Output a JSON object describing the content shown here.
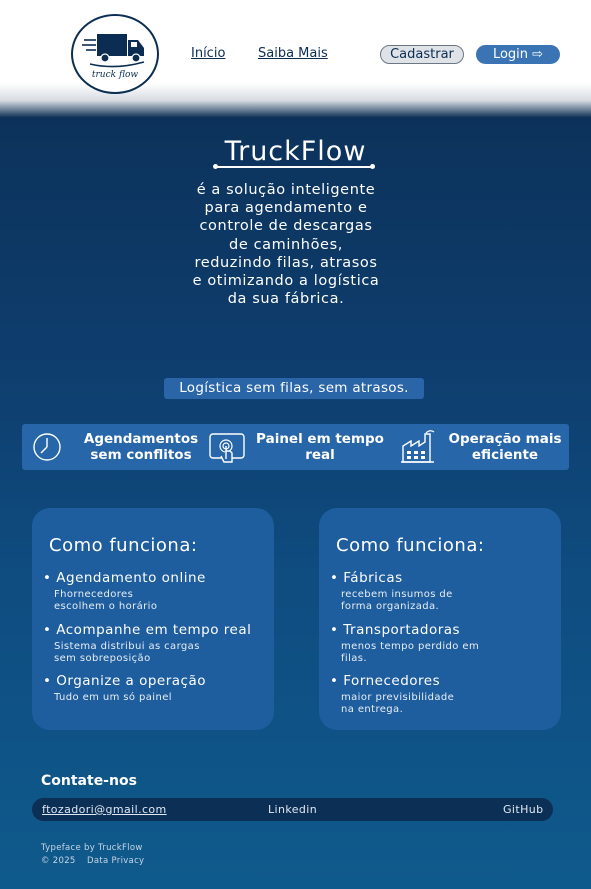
{
  "header": {
    "logo_text": "truck flow",
    "nav": {
      "home": "Início",
      "about": "Saiba Mais"
    },
    "register_label": "Cadastrar",
    "login_label": "Login ⇨"
  },
  "hero": {
    "title": "TruckFlow",
    "description": "é a solução inteligente para agendamento e controle de descargas de caminhões, reduzindo filas, atrasos e otimizando a logística da sua fábrica.",
    "tagline": "Logística sem filas, sem atrasos."
  },
  "features": [
    {
      "icon": "clock-icon",
      "label": "Agendamentos sem conflitos"
    },
    {
      "icon": "touch-panel-icon",
      "label": "Painel em tempo real"
    },
    {
      "icon": "factory-icon",
      "label": "Operação mais eficiente"
    }
  ],
  "cards": [
    {
      "title": "Como funciona:",
      "items": [
        {
          "title": "Agendamento online",
          "sub1": "Fhornecedores",
          "sub2": "escolhem o horário"
        },
        {
          "title": "Acompanhe em tempo real",
          "sub1": "Sistema distribui as cargas",
          "sub2": "sem sobreposição"
        },
        {
          "title": "Organize a operação",
          "sub1": "Tudo em um só painel",
          "sub2": ""
        }
      ]
    },
    {
      "title": "Como funciona:",
      "items": [
        {
          "title": "Fábricas",
          "sub1": "recebem insumos de",
          "sub2": "forma organizada."
        },
        {
          "title": "Transportadoras",
          "sub1": "menos tempo perdido em",
          "sub2": "filas."
        },
        {
          "title": "Fornecedores",
          "sub1": "maior previsibilidade",
          "sub2": "na entrega."
        }
      ]
    }
  ],
  "contact": {
    "title": "Contate-nos",
    "email": "ftozadori@gmail.com",
    "linkedin": "Linkedin",
    "github": "GitHub"
  },
  "footer": {
    "typeface": "Typeface by TruckFlow",
    "copyright": "© 2025",
    "privacy": "Data Privacy"
  },
  "colors": {
    "brand_dark": "#0b2d52",
    "accent": "#3a74b5",
    "card_bg": "#1e5d9e"
  }
}
